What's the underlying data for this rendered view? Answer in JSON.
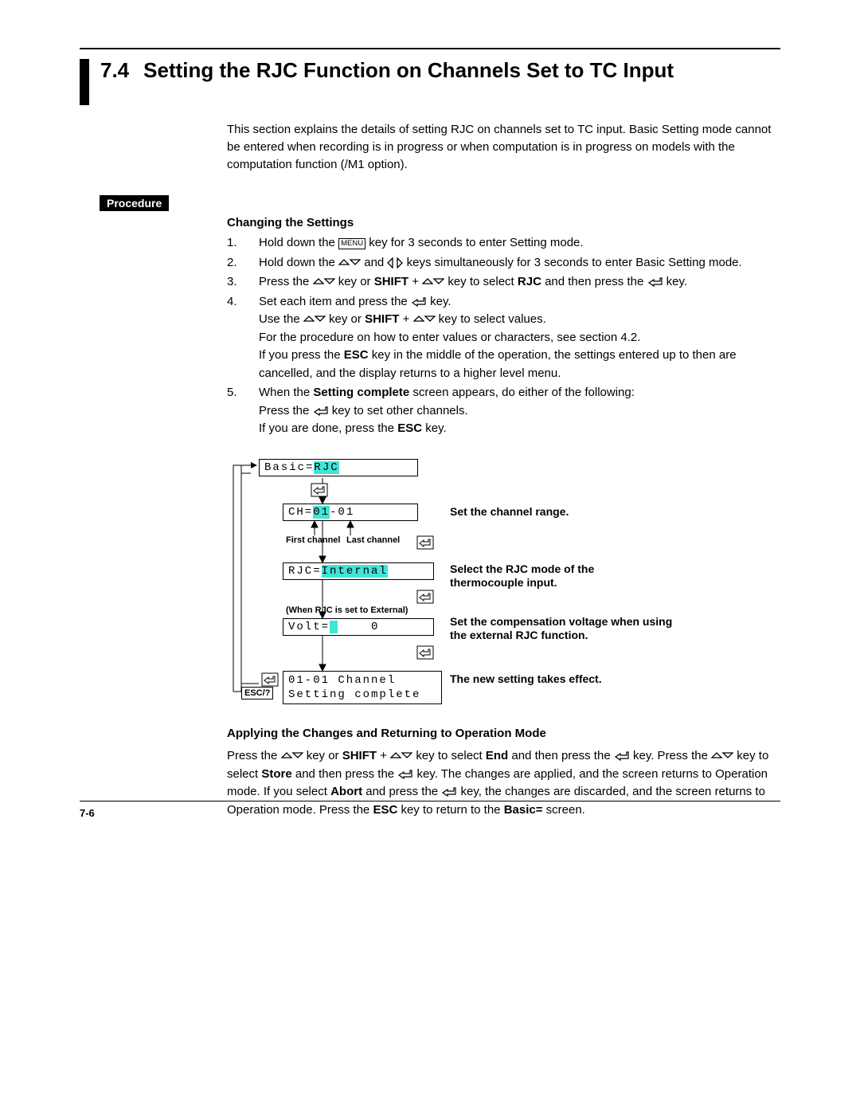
{
  "section": {
    "number": "7.4",
    "title": "Setting the RJC Function on Channels Set to TC Input",
    "intro": "This section explains the details of setting RJC on channels set to TC input. Basic Setting mode cannot be entered when recording is in progress or when computation is in progress on models with the computation function (/M1 option)."
  },
  "labels": {
    "procedure": "Procedure",
    "changing": "Changing the Settings",
    "applying": "Applying the Changes and Returning to Operation Mode",
    "esc_key": "ESC/?"
  },
  "steps": [
    {
      "n": "1.",
      "pre": "Hold down the ",
      "key_box": "MENU",
      "post": " key for 3 seconds to enter Setting mode."
    },
    {
      "n": "2.",
      "line_a_pre": "Hold down the ",
      "line_a_post": " and ",
      "line_a_end": " keys simultaneously for 3 seconds to enter Basic Setting mode."
    },
    {
      "n": "3.",
      "pre": "Press the ",
      "mid1": " key or ",
      "shift": "SHIFT",
      "mid2": " + ",
      "mid3": " key to select ",
      "bold": "RJC",
      "post1": " and then press the ",
      "post2": " key."
    },
    {
      "n": "4.",
      "line1_pre": "Set each item and press the ",
      "line1_post": " key.",
      "line2_pre": "Use the ",
      "line2_mid": " key or ",
      "line2_shift": "SHIFT",
      "line2_plus": " + ",
      "line2_end": " key to select values.",
      "line3": "For the procedure on how to enter values or characters, see section 4.2.",
      "line4a": "If you press the ",
      "line4_esc": "ESC",
      "line4b": " key in the middle of the operation, the settings entered up to then are cancelled, and the display returns to a higher level menu."
    },
    {
      "n": "5.",
      "line1a": "When the ",
      "line1_bold": "Setting complete",
      "line1b": " screen appears, do either of the following:",
      "line2a": "Press the ",
      "line2b": " key to set other channels.",
      "line3a": "If you are done, press the ",
      "line3_esc": "ESC",
      "line3b": " key."
    }
  ],
  "diagram": {
    "box1_pre": "Basic=",
    "box1_hl": "RJC",
    "box2_pre": "CH=",
    "box2_hl": "01",
    "box2_suf": "-01",
    "box3_pre": "RJC=",
    "box3_hl": "Internal",
    "box4_pre": "Volt=",
    "box4_hl": " ",
    "box4_suf": "    0",
    "box5_line1": "01-01 Channel",
    "box5_line2": "Setting complete",
    "first_ch": "First channel",
    "last_ch": "Last channel",
    "when_external": "(When RJC is set to External)",
    "ann1": "Set the channel range.",
    "ann2": "Select the RJC mode of the thermocouple input.",
    "ann3": "Set the compensation voltage when using the external RJC function.",
    "ann4": "The new setting takes effect."
  },
  "closing": {
    "t1a": "Press the ",
    "t1b": " key or ",
    "shift": "SHIFT",
    "t1c": " + ",
    "t1d": " key to select ",
    "end": "End",
    "t1e": " and then press the ",
    "t1f": " key.  Press the ",
    "t2a": " key to select ",
    "store": "Store",
    "t2b": " and then press the ",
    "t2c": " key.  The changes are applied, and the screen returns to Operation mode.  If you select ",
    "abort": "Abort",
    "t2d": " and press the ",
    "t2e": " key, the changes are discarded, and the screen returns to Operation mode.  Press the ",
    "esc": "ESC",
    "t2f": " key to return to the ",
    "basic": "Basic=",
    "t2g": " screen."
  },
  "page": "7-6"
}
